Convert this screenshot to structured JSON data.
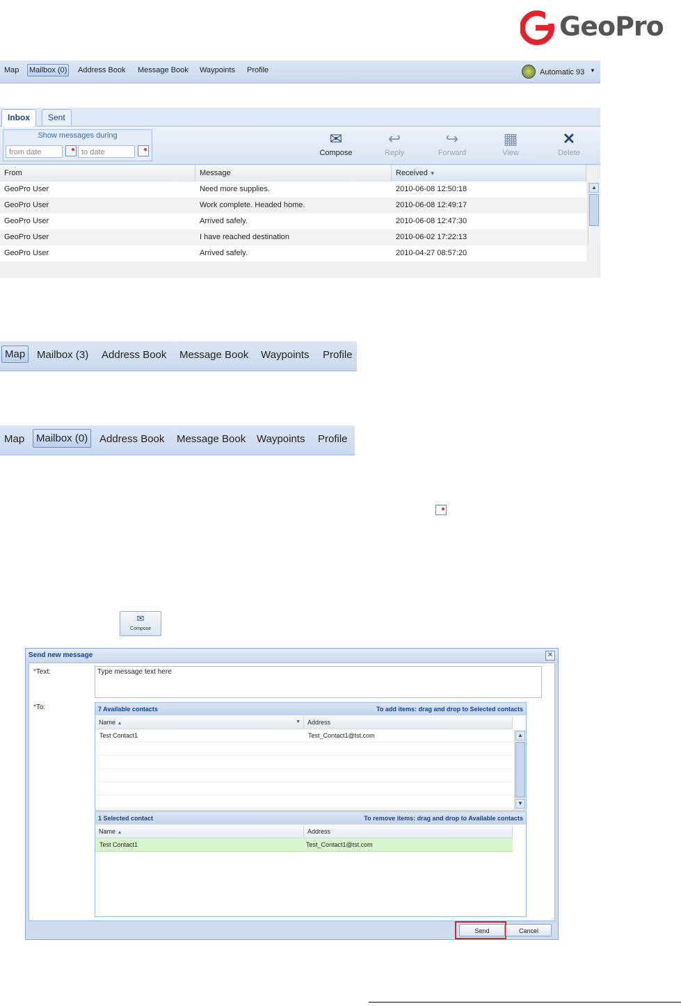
{
  "brand": {
    "logo_text": "GeoPro",
    "accent": "#e3232c"
  },
  "nav_main": {
    "items": [
      "Map",
      "Mailbox (0)",
      "Address Book",
      "Message Book",
      "Waypoints",
      "Profile"
    ],
    "active_index": 1,
    "user_label": "Automatic 93"
  },
  "mailbox": {
    "tabs": [
      "Inbox",
      "Sent"
    ],
    "filter": {
      "title": "Show messages during",
      "from_placeholder": "from date",
      "to_placeholder": "to date"
    },
    "buttons": [
      "Compose",
      "Reply",
      "Forward",
      "View",
      "Delete"
    ],
    "columns": [
      "From",
      "Message",
      "Received"
    ],
    "rows": [
      [
        "GeoPro User",
        "Need more supplies.",
        "2010-06-08 12:50:18"
      ],
      [
        "GeoPro User",
        "Work complete. Headed home.",
        "2010-06-08 12:49:17"
      ],
      [
        "GeoPro User",
        "Arrived safely.",
        "2010-06-08 12:47:30"
      ],
      [
        "GeoPro User",
        "I have reached destination",
        "2010-06-02 17:22:13"
      ],
      [
        "GeoPro User",
        "Arrived safely.",
        "2010-04-27 08:57:20"
      ]
    ]
  },
  "nav_big_1": {
    "items": [
      "Map",
      "Mailbox (3)",
      "Address Book",
      "Message Book",
      "Waypoints",
      "Profile"
    ],
    "active_index": 0
  },
  "nav_big_2": {
    "items": [
      "Map",
      "Mailbox (0)",
      "Address Book",
      "Message Book",
      "Waypoints",
      "Profile"
    ],
    "active_index": 1
  },
  "compose_thumb": {
    "label": "Compose"
  },
  "dialog": {
    "title": "Send new message",
    "text_label": "Text:",
    "to_label": "To:",
    "text_value": "Type message text here",
    "available": {
      "title": "7 Available contacts",
      "hint": "To add items: drag and drop to Selected contacts",
      "col_name": "Name",
      "col_address": "Address",
      "rows": [
        [
          "Test Contact1",
          "Test_Contact1@tst.com"
        ]
      ]
    },
    "selected": {
      "title": "1 Selected contact",
      "hint": "To remove items: drag and drop to Available contacts",
      "col_name": "Name",
      "col_address": "Address",
      "rows": [
        [
          "Test Contact1",
          "Test_Contact1@tst.com"
        ]
      ]
    },
    "send_label": "Send",
    "cancel_label": "Cancel"
  }
}
